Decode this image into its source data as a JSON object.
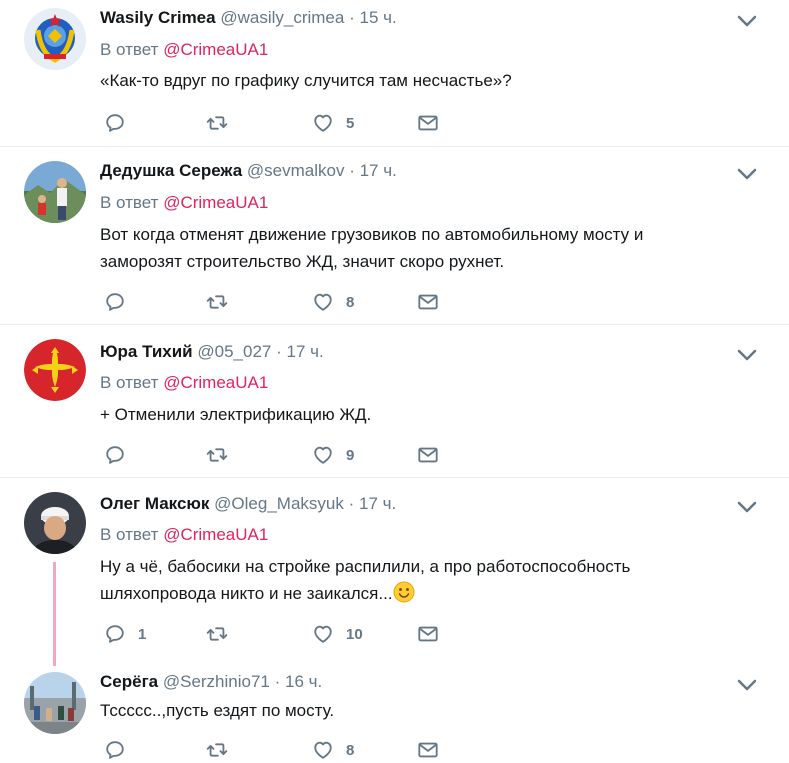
{
  "tweets": [
    {
      "name": "Wasily Crimea",
      "handle": "@wasily_crimea",
      "dot": "·",
      "time": "15 ч.",
      "reply_prefix": "В ответ",
      "reply_mention": "@CrimeaUA1",
      "text": "«Как-то вдруг по графику случится там несчастье»?",
      "replies": "",
      "retweets": "",
      "likes": "5"
    },
    {
      "name": "Дедушка Сережа",
      "handle": "@sevmalkov",
      "dot": "·",
      "time": "17 ч.",
      "reply_prefix": "В ответ",
      "reply_mention": "@CrimeaUA1",
      "text_line1": "Вот когда отменят движение грузовиков по автомобильному мосту и",
      "text_line2": "заморозят строительство ЖД, значит скоро рухнет.",
      "replies": "",
      "retweets": "",
      "likes": "8"
    },
    {
      "name": "Юра Тихий",
      "handle": "@05_027",
      "dot": "·",
      "time": "17 ч.",
      "reply_prefix": "В ответ",
      "reply_mention": "@CrimeaUA1",
      "text": "+ Отменили электрификацию ЖД.",
      "replies": "",
      "retweets": "",
      "likes": "9"
    },
    {
      "name": "Олег Максюк",
      "handle": "@Oleg_Maksyuk",
      "dot": "·",
      "time": "17 ч.",
      "reply_prefix": "В ответ",
      "reply_mention": "@CrimeaUA1",
      "text_line1": "Ну а чё, бабосики на стройке распилили, а про работоспособность",
      "text_line2": "шляхопровода никто и не заикался...",
      "replies": "1",
      "retweets": "",
      "likes": "10"
    },
    {
      "name": "Серёга",
      "handle": "@Serzhinio71",
      "dot": "·",
      "time": "16 ч.",
      "text": "Тссссс..,пусть ездят по мосту.",
      "replies": "",
      "retweets": "",
      "likes": "8"
    }
  ],
  "icons": {
    "reply": "reply-icon",
    "retweet": "retweet-icon",
    "like": "like-icon",
    "dm": "direct-message-icon",
    "more": "chevron-down-icon",
    "emoji": "slightly-smiling-face-icon"
  },
  "colors": {
    "mention": "#e0245e",
    "secondary": "#657786",
    "thread_line": "#f4a6bd"
  }
}
